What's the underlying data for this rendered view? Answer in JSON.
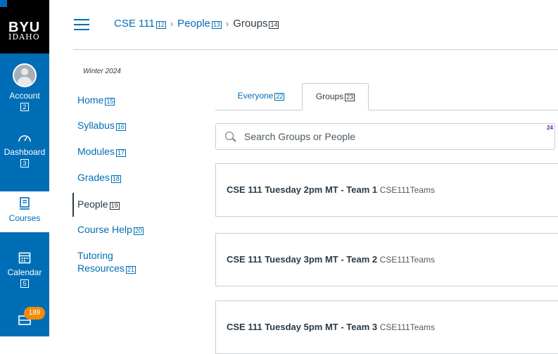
{
  "logo": {
    "line1": "BYU",
    "line2": "IDAHO"
  },
  "global_nav": {
    "account": {
      "label": "Account",
      "tag": "2"
    },
    "dashboard": {
      "label": "Dashboard",
      "tag": "3"
    },
    "courses": {
      "label": "Courses"
    },
    "calendar": {
      "label": "Calendar",
      "tag": "5"
    },
    "inbox": {
      "badge": "189"
    }
  },
  "breadcrumb": [
    {
      "label": "CSE 111",
      "tag": "12"
    },
    {
      "label": "People",
      "tag": "13"
    },
    {
      "label": "Groups",
      "tag": "14"
    }
  ],
  "course_nav": {
    "term": "Winter 2024",
    "items": [
      {
        "label": "Home",
        "tag": "15"
      },
      {
        "label": "Syllabus",
        "tag": "16"
      },
      {
        "label": "Modules",
        "tag": "17"
      },
      {
        "label": "Grades",
        "tag": "18"
      },
      {
        "label": "People",
        "tag": "19"
      },
      {
        "label": "Course Help",
        "tag": "20"
      },
      {
        "label_line1": "Tutoring",
        "label_line2": "Resources",
        "tag": "21"
      }
    ]
  },
  "tabs": [
    {
      "label": "Everyone",
      "tag": "22"
    },
    {
      "label": "Groups",
      "tag": "23"
    }
  ],
  "search": {
    "placeholder": "Search Groups or People",
    "tag": "24"
  },
  "groups": [
    {
      "name": "CSE 111 Tuesday 2pm MT - Team 1",
      "set": "CSE111Teams"
    },
    {
      "name": "CSE 111 Tuesday 3pm MT - Team 2",
      "set": "CSE111Teams"
    },
    {
      "name": "CSE 111 Tuesday 5pm MT - Team 3",
      "set": "CSE111Teams"
    }
  ],
  "colors": {
    "brand": "#006eb6",
    "logo_bg": "#000000",
    "badge": "#f58a07",
    "text": "#2d3b45",
    "border": "#c7cdd1"
  }
}
